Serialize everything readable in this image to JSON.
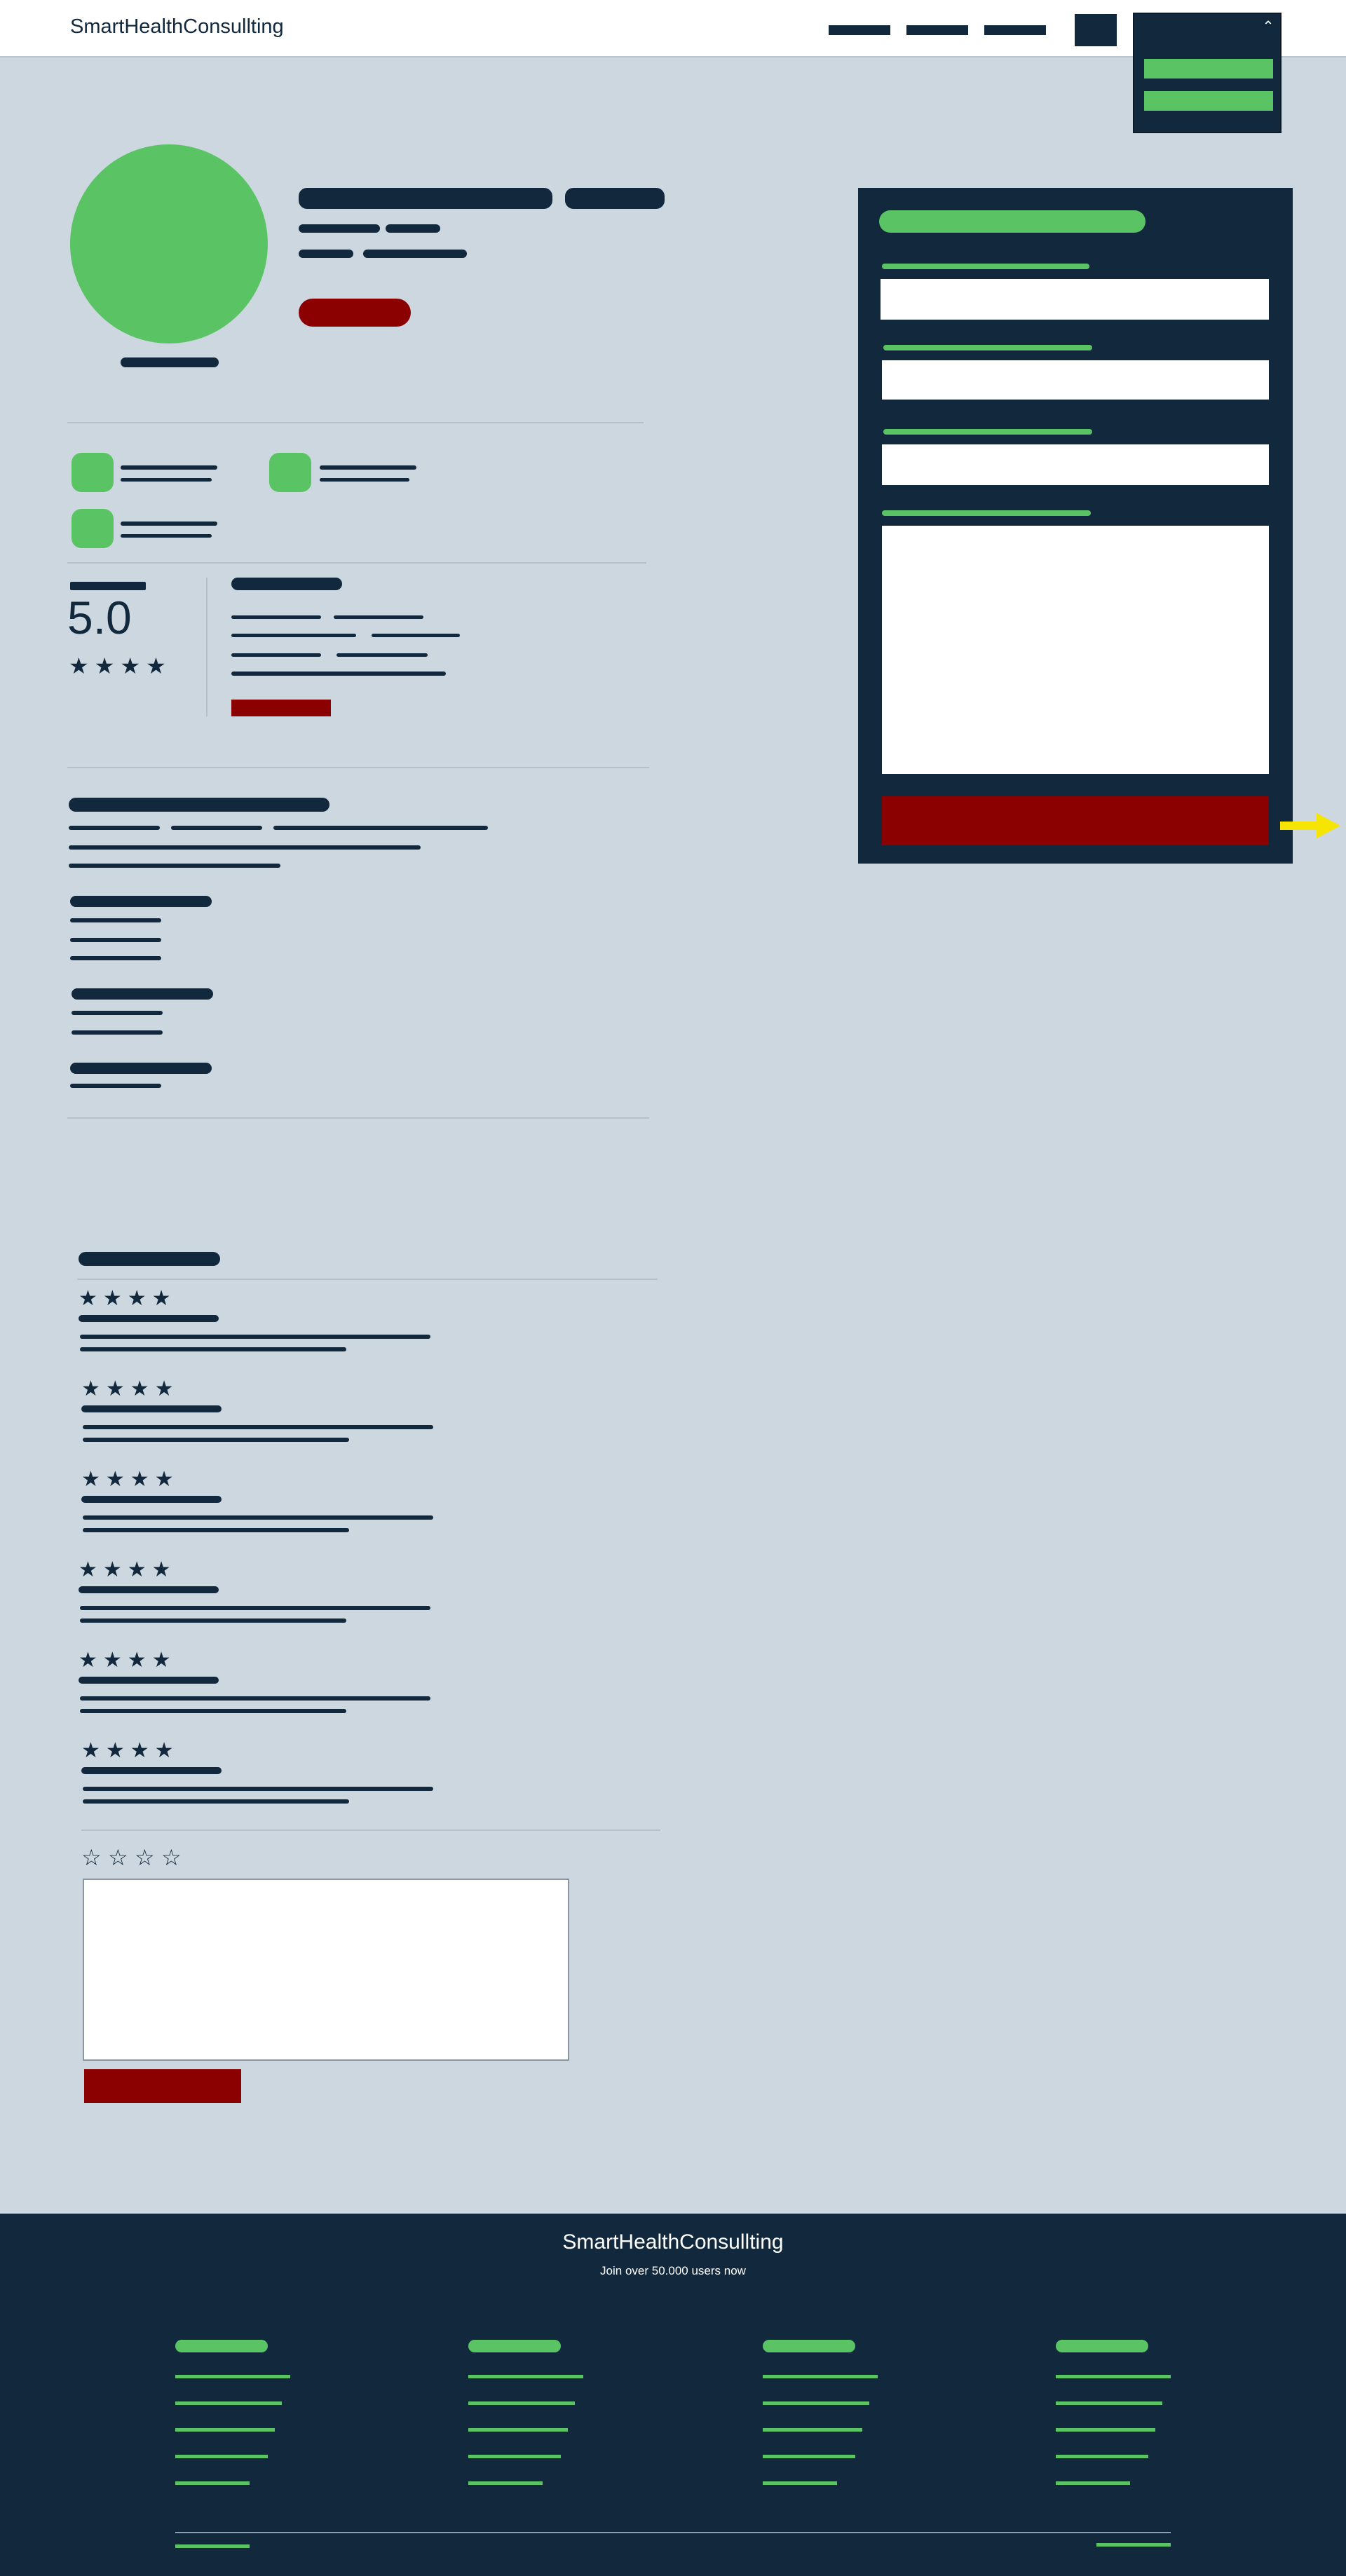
{
  "header": {
    "brand": "SmartHealthConsullting",
    "nav_items": [
      "",
      "",
      ""
    ],
    "dropdown": {
      "toggle_icon": "chevron-up-icon",
      "items": [
        "",
        ""
      ]
    }
  },
  "profile": {
    "rating": {
      "value": "5.0",
      "stars": "★★★★"
    }
  },
  "reviews": {
    "count": 6,
    "star_glyphs": "★★★★",
    "rating_input_stars": [
      "☆",
      "☆",
      "☆",
      "☆"
    ]
  },
  "footer": {
    "brand": "SmartHealthConsullting",
    "tagline": "Join over 50.000 users now"
  },
  "colors": {
    "navy": "#12283d",
    "green": "#5ac465",
    "red": "#8b0000",
    "background": "#cdd7e0",
    "arrow": "#f5e500"
  }
}
